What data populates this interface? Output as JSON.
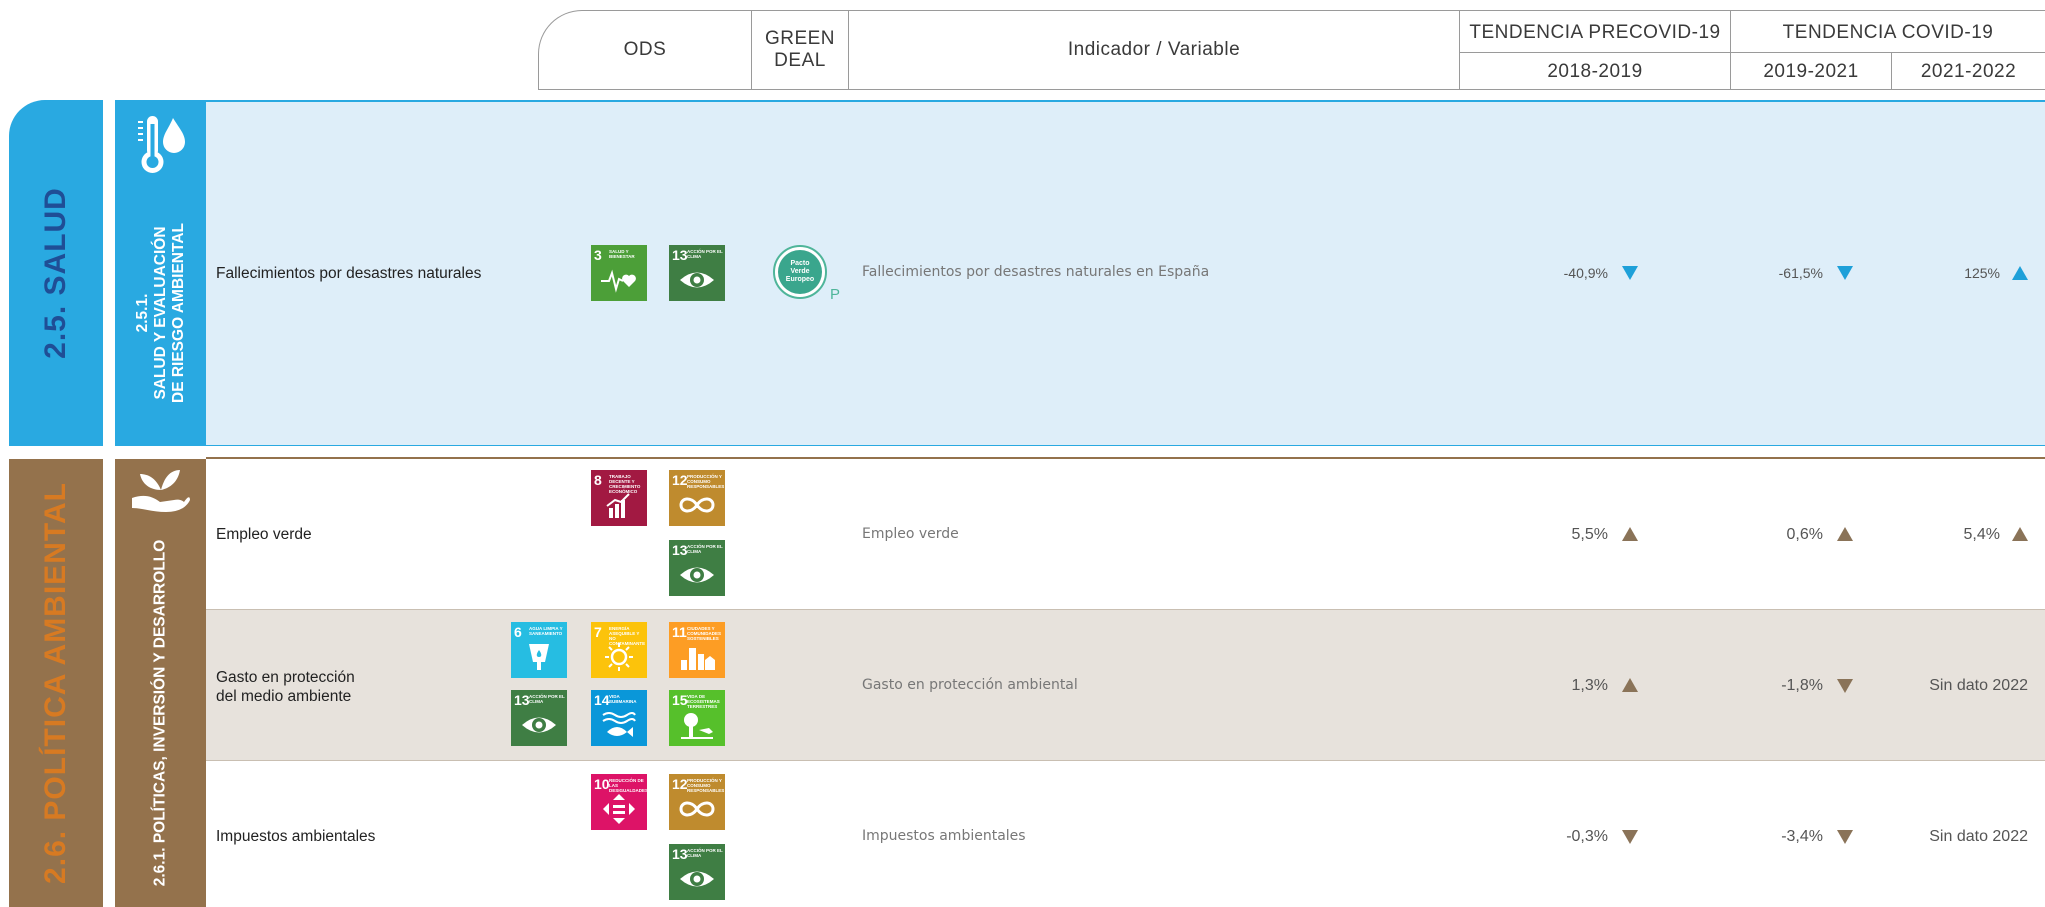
{
  "colors": {
    "salud_blue": "#29a9e1",
    "salud_dark_blue": "#1f4e96",
    "salud_row_bg": "#deeef9",
    "arrow_blue": "#1ea0d9",
    "politica_brown": "#94724c",
    "politica_orange": "#d77a22",
    "arrow_brown": "#8a7358",
    "row_beige": "#e7e2dc"
  },
  "header": {
    "ods": "ODS",
    "green_deal_line1": "GREEN",
    "green_deal_line2": "DEAL",
    "indicador": "Indicador / Variable",
    "tendencia_precovid": "TENDENCIA PRECOVID-19",
    "tendencia_covid": "TENDENCIA COVID-19",
    "period_1": "2018-2019",
    "period_2": "2019-2021",
    "period_3": "2021-2022"
  },
  "sections": {
    "salud": {
      "title": "2.5. SALUD",
      "subtitle_line1": "2.5.1.",
      "subtitle_line2": "SALUD Y EVALUACIÓN",
      "subtitle_line3": "DE RIESGO AMBIENTAL",
      "icon": "thermometer-drop-icon"
    },
    "politica": {
      "title": "2.6. POLÍTICA AMBIENTAL",
      "subtitle": "2.6.1. POLÍTICAS, INVERSIÓN Y DESARROLLO",
      "icon": "hand-plant-icon"
    }
  },
  "green_deal_badge": {
    "line1": "Pacto",
    "line2": "Verde",
    "line3": "Europeo",
    "tag": "P"
  },
  "sdg": {
    "s3": {
      "num": "3",
      "title": "Salud y bienestar",
      "color": "#4c9f38"
    },
    "s6": {
      "num": "6",
      "title": "Agua limpia y saneamiento",
      "color": "#26bde2"
    },
    "s7": {
      "num": "7",
      "title": "Energía asequible y no contaminante",
      "color": "#fcc30b"
    },
    "s8": {
      "num": "8",
      "title": "Trabajo decente y crecimiento económico",
      "color": "#a21942"
    },
    "s10": {
      "num": "10",
      "title": "Reducción de las desigualdades",
      "color": "#dd1367"
    },
    "s11": {
      "num": "11",
      "title": "Ciudades y comunidades sostenibles",
      "color": "#fd9d24"
    },
    "s12": {
      "num": "12",
      "title": "Producción y consumo responsables",
      "color": "#bf8b2e"
    },
    "s13": {
      "num": "13",
      "title": "Acción por el clima",
      "color": "#3f7e44"
    },
    "s14": {
      "num": "14",
      "title": "Vida submarina",
      "color": "#0a97d9"
    },
    "s15": {
      "num": "15",
      "title": "Vida de ecosistemas terrestres",
      "color": "#56c02b"
    }
  },
  "rows": [
    {
      "label": "Fallecimientos por desastres naturales",
      "variable": "Fallecimientos por desastres naturales en España",
      "v1": "-40,9%",
      "t1": "down",
      "v2": "-61,5%",
      "t2": "down",
      "v3": "125%",
      "t3": "up"
    },
    {
      "label": "Empleo verde",
      "variable": "Empleo verde",
      "v1": "5,5%",
      "t1": "up",
      "v2": "0,6%",
      "t2": "up",
      "v3": "5,4%",
      "t3": "up"
    },
    {
      "label_line1": "Gasto en protección",
      "label_line2": "del medio ambiente",
      "variable": "Gasto en protección ambiental",
      "v1": "1,3%",
      "t1": "up",
      "v2": "-1,8%",
      "t2": "down",
      "v3": "Sin dato 2022"
    },
    {
      "label": "Impuestos ambientales",
      "variable": "Impuestos ambientales",
      "v1": "-0,3%",
      "t1": "down",
      "v2": "-3,4%",
      "t2": "down",
      "v3": "Sin dato 2022"
    }
  ]
}
